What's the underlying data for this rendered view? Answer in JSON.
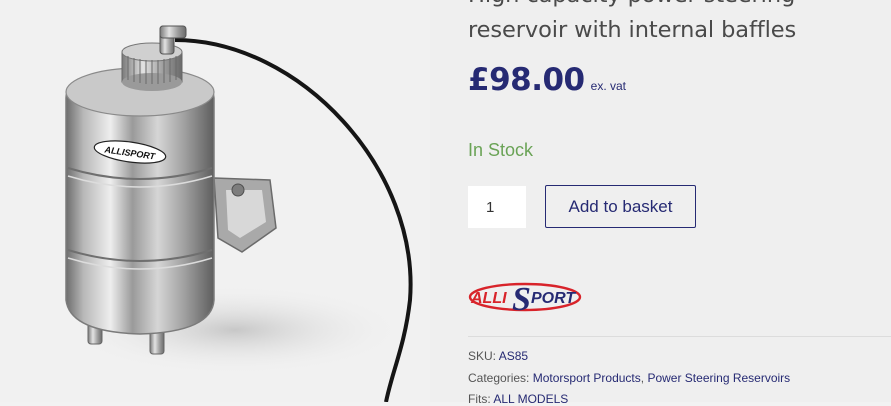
{
  "product": {
    "title_line1": "High capacity power steering",
    "title_line2": "reservoir with internal baffles",
    "price": "£98.00",
    "price_suffix": "ex. vat",
    "stock_status": "In Stock",
    "quantity": "1",
    "add_to_basket_label": "Add to basket"
  },
  "brand": {
    "logo_text_left": "ALLI",
    "logo_text_right": "PORT",
    "tank_logo_text": "ALLISPORT",
    "colors": {
      "blue": "#262a73",
      "red": "#d8232a"
    }
  },
  "meta": {
    "sku_label": "SKU:",
    "sku_value": "AS85",
    "categories_label": "Categories:",
    "categories": [
      "Motorsport Products",
      "Power Steering Reservoirs"
    ],
    "categories_separator": ",",
    "fits_label": "Fits:",
    "fits_value": "ALL MODELS"
  },
  "colors": {
    "accent": "#262a73",
    "stock": "#6aa356"
  }
}
